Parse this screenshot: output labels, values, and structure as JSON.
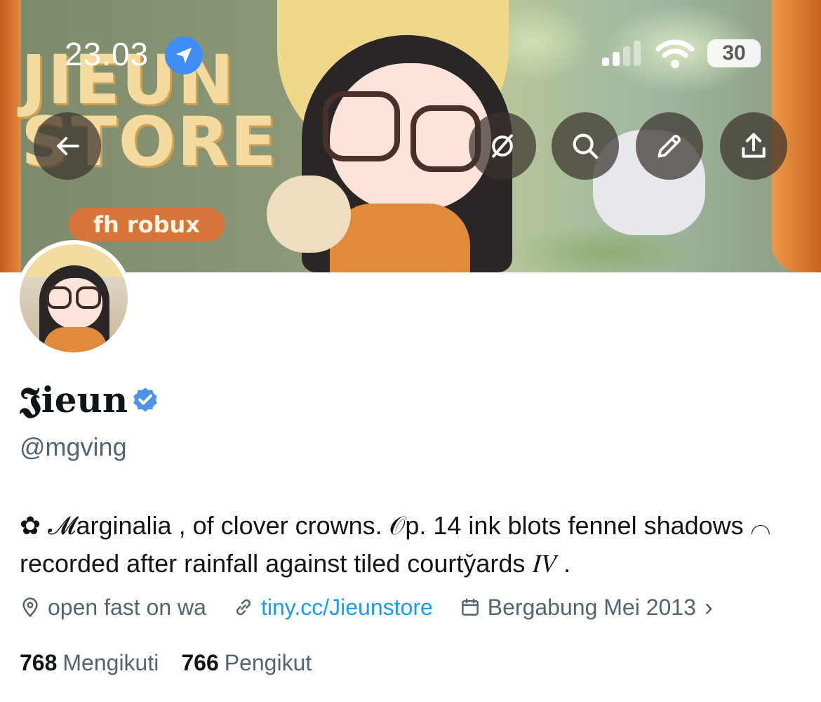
{
  "status_bar": {
    "time": "23.03",
    "battery": "30"
  },
  "banner": {
    "logo_line1": "JIEUN",
    "logo_line2": "STORE",
    "logo_tag": "fh robux"
  },
  "profile": {
    "name": "𝕵ieun",
    "handle": "@mgving",
    "bio": "✿ 𝓜arginalia , of clover crowns. 𝒪p. 14 ink blots fennel shadows ⌒ recorded after rainfall against tiled courty̆ards 𝐼𝑉 .",
    "location": "open fast on wa",
    "link": "tiny.cc/Jieunstore",
    "joined": "Bergabung Mei 2013",
    "joined_chevron": "›"
  },
  "stats": {
    "following_count": "768",
    "following_label": "Mengikuti",
    "followers_count": "766",
    "followers_label": "Pengikut"
  },
  "colors": {
    "accent_blue": "#1d9bf0",
    "verified_blue": "#4d93e8",
    "secondary_text": "#536471",
    "primary_text": "#0f1419",
    "location_pill": "#3f8ef5"
  },
  "icons": {
    "back": "arrow-left-icon",
    "sync": "slashed-circle-icon",
    "search": "search-icon",
    "edit": "pencil-icon",
    "share": "share-icon",
    "location": "location-pin-icon",
    "link": "link-icon",
    "calendar": "calendar-icon"
  }
}
